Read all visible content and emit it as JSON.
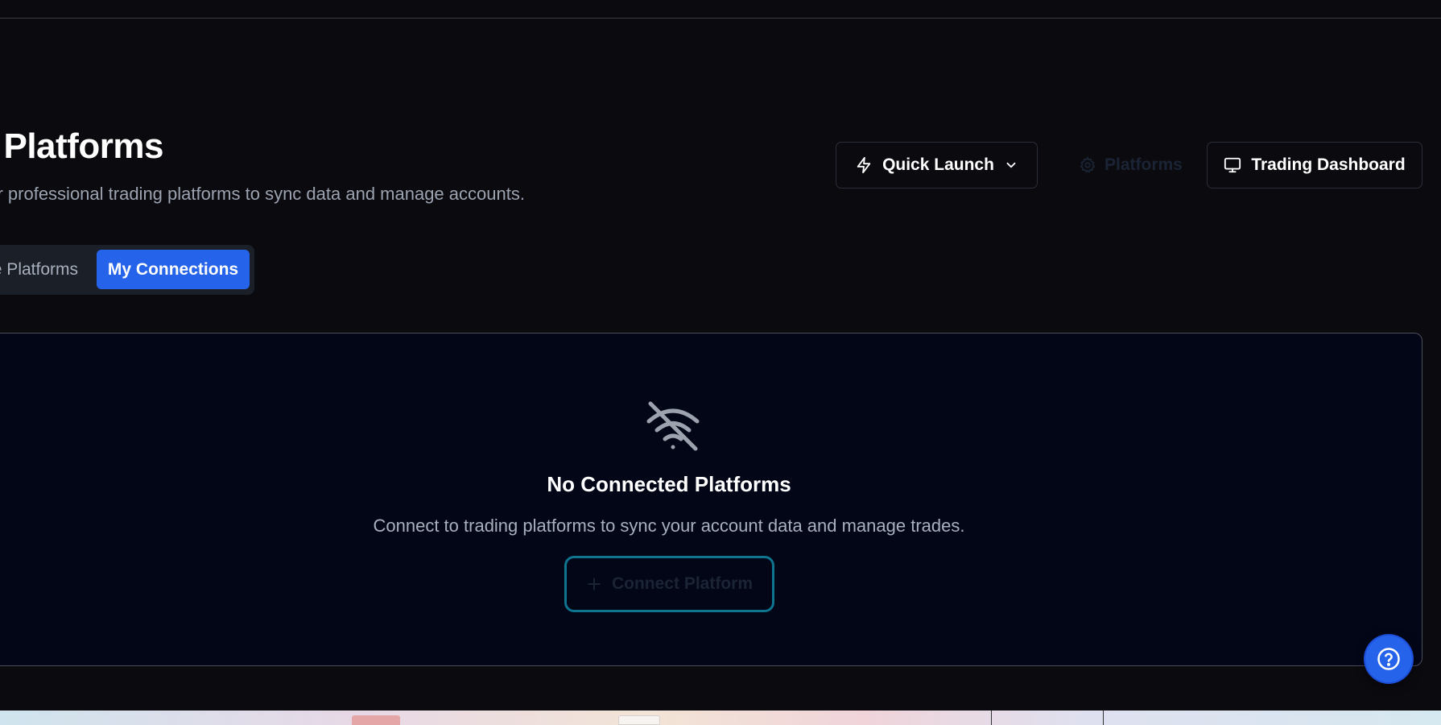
{
  "header": {
    "title": "ng Platforms",
    "subtitle": "our professional trading platforms to sync data and manage accounts."
  },
  "actions": {
    "quick_launch_label": "Quick Launch",
    "platforms_label": "Platforms",
    "trading_dashboard_label": "Trading Dashboard"
  },
  "tabs": [
    {
      "label": "e Platforms",
      "active": false
    },
    {
      "label": "My Connections",
      "active": true
    }
  ],
  "empty_state": {
    "icon": "wifi-off-icon",
    "title": "No Connected Platforms",
    "description": "Connect to trading platforms to sync your account data and manage trades.",
    "button_label": "Connect Platform"
  },
  "colors": {
    "background": "#0b0a0f",
    "panel": "#020617",
    "accent": "#2563eb",
    "connect_border": "#0e7490",
    "muted_text": "#a9b0bd"
  }
}
